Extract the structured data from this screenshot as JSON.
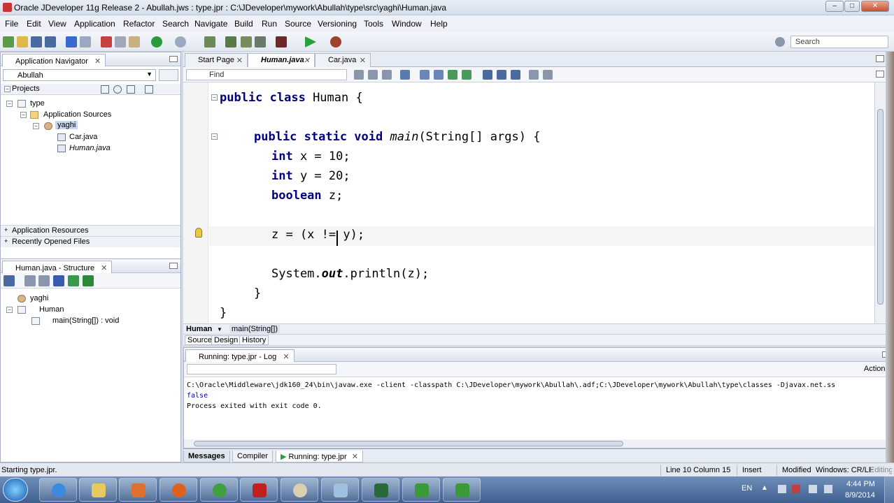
{
  "window": {
    "title": "Oracle JDeveloper 11g Release 2 - Abullah.jws : type.jpr : C:\\JDeveloper\\mywork\\Abullah\\type\\src\\yaghi\\Human.java"
  },
  "menu": [
    "File",
    "Edit",
    "View",
    "Application",
    "Refactor",
    "Search",
    "Navigate",
    "Build",
    "Run",
    "Source",
    "Versioning",
    "Tools",
    "Window",
    "Help"
  ],
  "toolbar": {
    "search_placeholder": "Search"
  },
  "navigator": {
    "tab_label": "Application Navigator",
    "application": "Abullah",
    "projects_label": "Projects",
    "tree": {
      "project": "type",
      "sources": "Application Sources",
      "package": "yaghi",
      "files": [
        "Car.java",
        "Human.java"
      ]
    },
    "app_resources": "Application Resources",
    "recent_files": "Recently Opened Files"
  },
  "structure": {
    "tab_label": "Human.java - Structure",
    "package": "yaghi",
    "class": "Human",
    "method": "main(String[]) : void"
  },
  "editor": {
    "tabs": [
      "Start Page",
      "Human.java",
      "Car.java"
    ],
    "find_placeholder": "Find",
    "lines": {
      "l1_kw": "public class",
      "l1_rest": " Human {",
      "l3_kw": "public static void",
      "l3_method": "main",
      "l3_rest": "(String[] args) {",
      "l4_kw": "int",
      "l4_rest": " x = 10;",
      "l5_kw": "int",
      "l5_rest": " y = 20;",
      "l6_kw": "boolean",
      "l6_rest": " z;",
      "l8": "z = (x != y);",
      "l10_a": "System.",
      "l10_out": "out",
      "l10_b": ".println(z);",
      "l11": "}",
      "l12": "}"
    },
    "breadcrumb": [
      "Human",
      "main(String[])"
    ],
    "bottom_tabs": [
      "Source",
      "Design",
      "History"
    ]
  },
  "log": {
    "tab_label": "Running: type.jpr - Log",
    "actions_label": "Actions",
    "lines": [
      "C:\\Oracle\\Middleware\\jdk160_24\\bin\\javaw.exe -client -classpath C:\\JDeveloper\\mywork\\Abullah\\.adf;C:\\JDeveloper\\mywork\\Abullah\\type\\classes -Djavax.net.ss",
      "false",
      "Process exited with exit code 0."
    ],
    "bottom_tabs": [
      "Messages",
      "Compiler",
      "Running: type.jpr"
    ]
  },
  "status": {
    "left": "Starting type.jpr.",
    "position": "Line 10 Column 15",
    "mode": "Insert",
    "modified": "Modified",
    "line_endings": "Windows: CR/LF",
    "encoding": "Editing"
  },
  "taskbar": {
    "language": "EN",
    "time": "4:44 PM",
    "date": "8/9/2014"
  },
  "colors": {
    "keyword": "#000080",
    "log_output": "#0000cc",
    "current_line": "#f5f5f5"
  }
}
